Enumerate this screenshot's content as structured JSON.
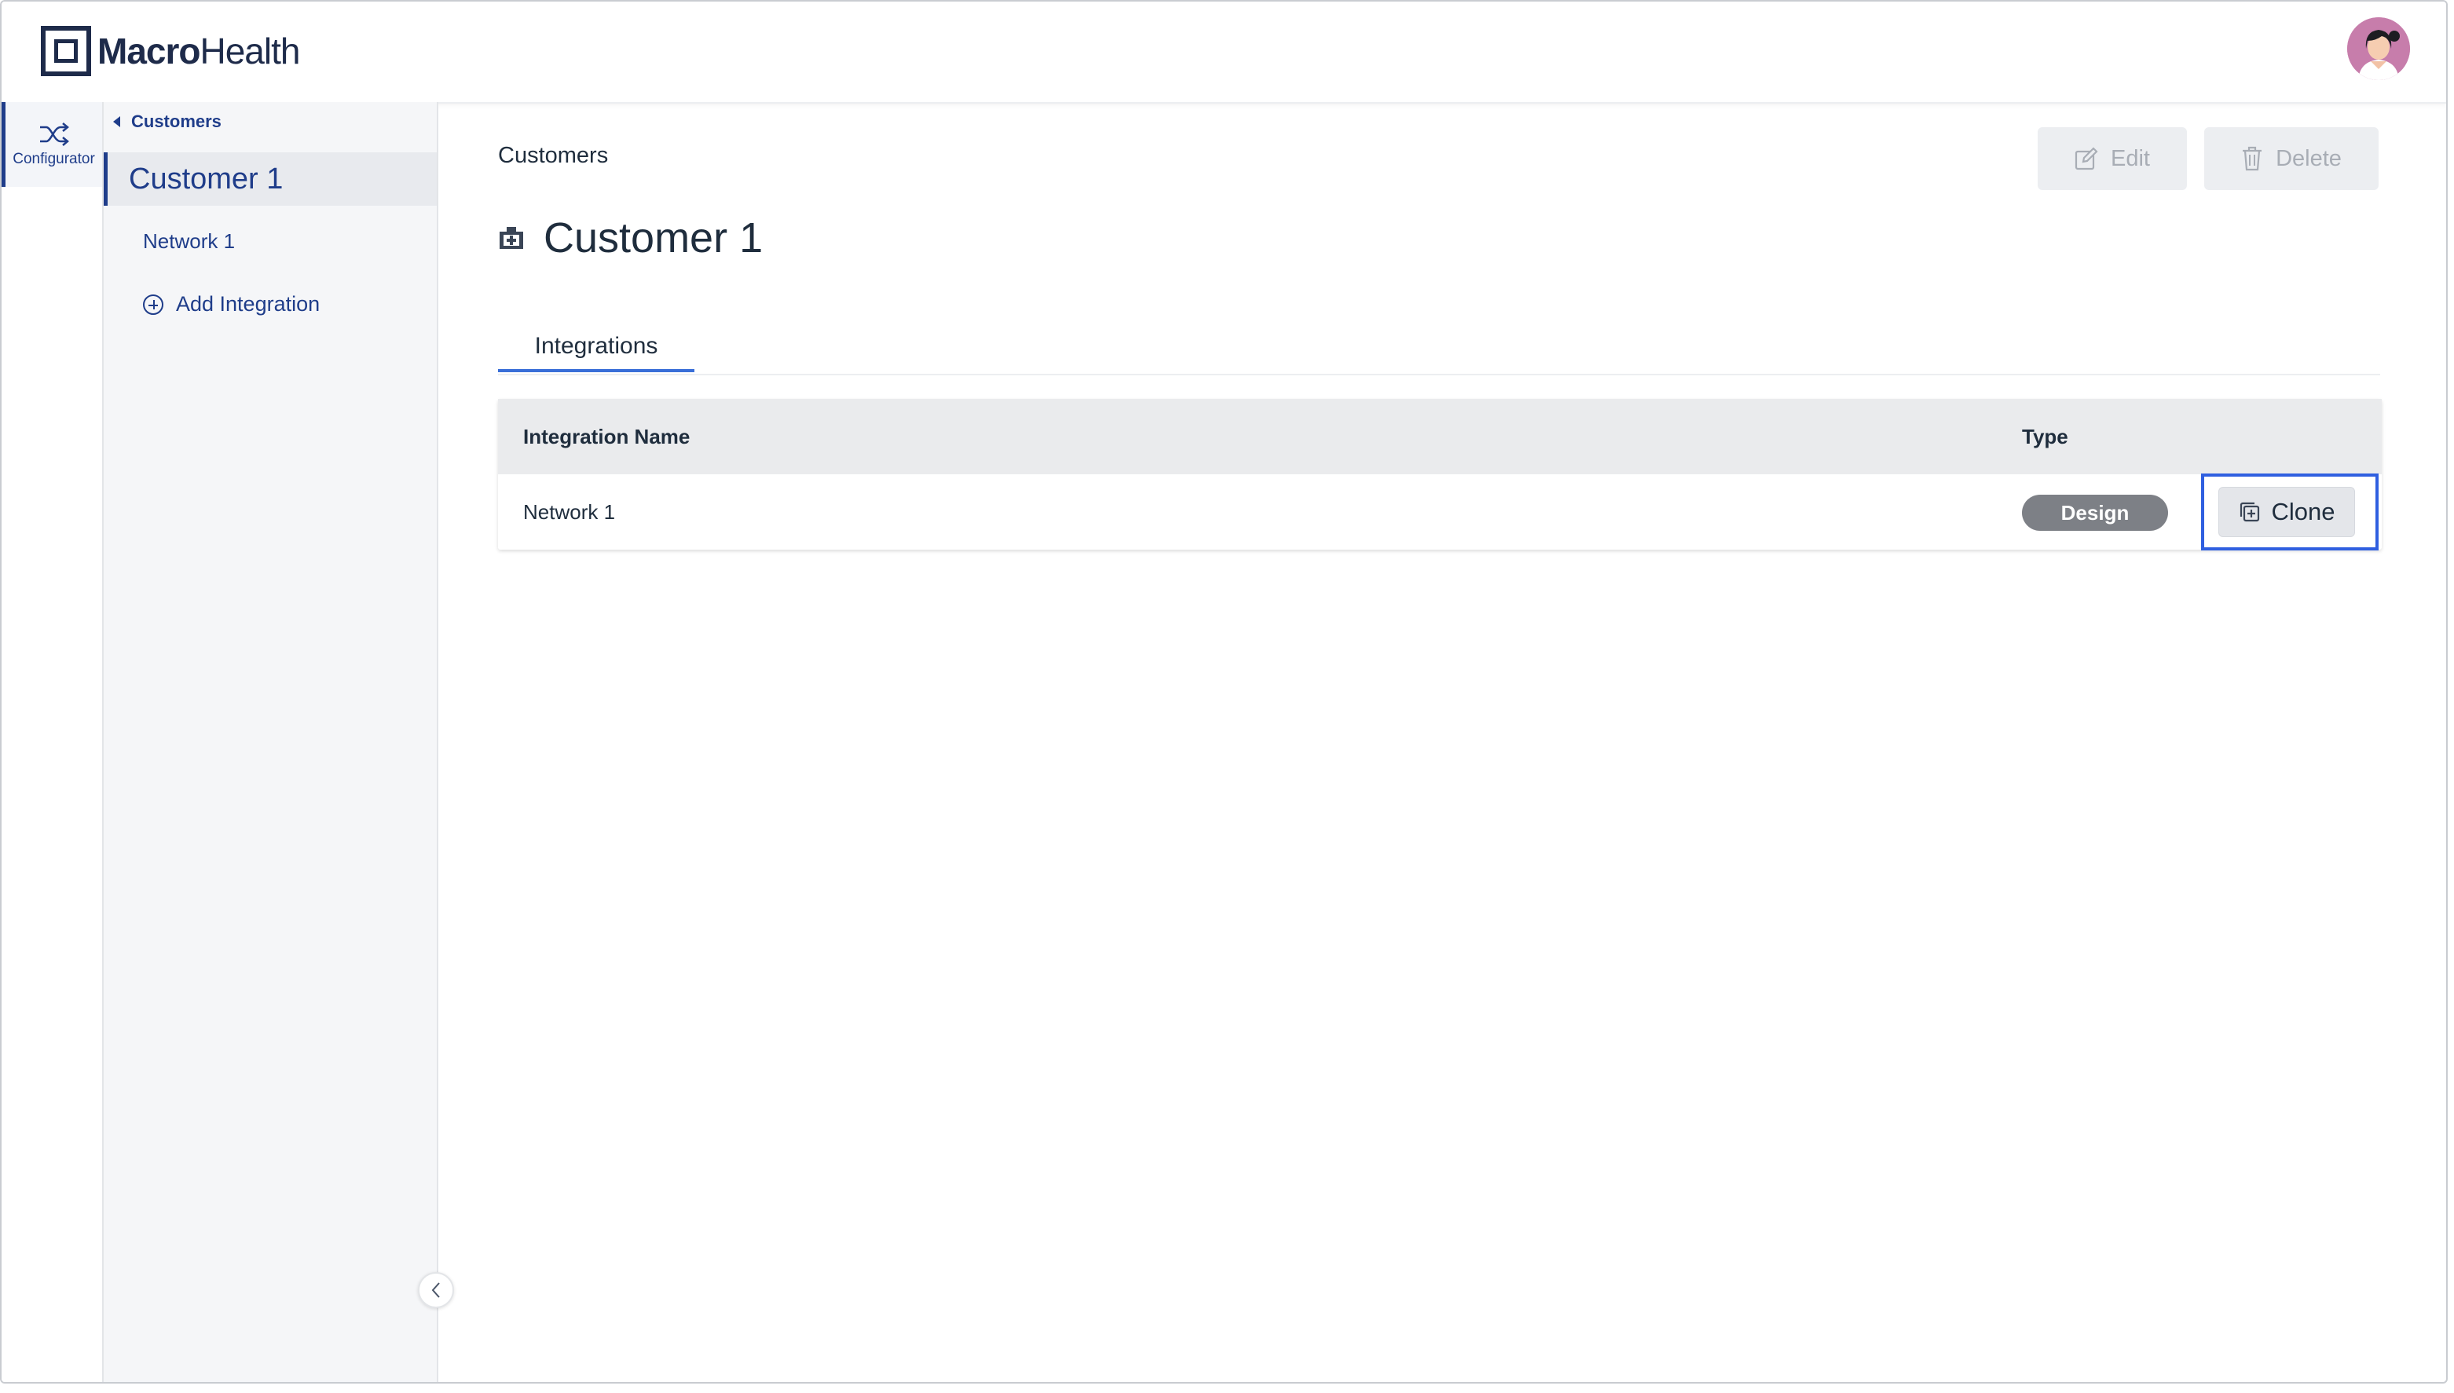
{
  "app": {
    "logo": {
      "bold": "Macro",
      "light": "Health"
    }
  },
  "rail": {
    "items": [
      {
        "label": "Configurator",
        "icon": "shuffle-icon"
      }
    ]
  },
  "sidebar": {
    "back_label": "Customers",
    "active_item": "Customer 1",
    "items": [
      {
        "label": "Network 1"
      }
    ],
    "add_label": "Add Integration"
  },
  "main": {
    "breadcrumb": "Customers",
    "edit_label": "Edit",
    "delete_label": "Delete",
    "title": "Customer 1",
    "tabs": [
      {
        "label": "Integrations",
        "active": true
      }
    ],
    "table": {
      "columns": [
        "Integration Name",
        "Type"
      ],
      "rows": [
        {
          "name": "Network 1",
          "type": "Design",
          "action": "Clone"
        }
      ]
    }
  },
  "colors": {
    "brand": "#1e2b4a",
    "accent": "#1f3d8a",
    "tab_underline": "#3a6fd8",
    "focus_outline": "#2f5fe0",
    "badge": "#7d8086"
  }
}
